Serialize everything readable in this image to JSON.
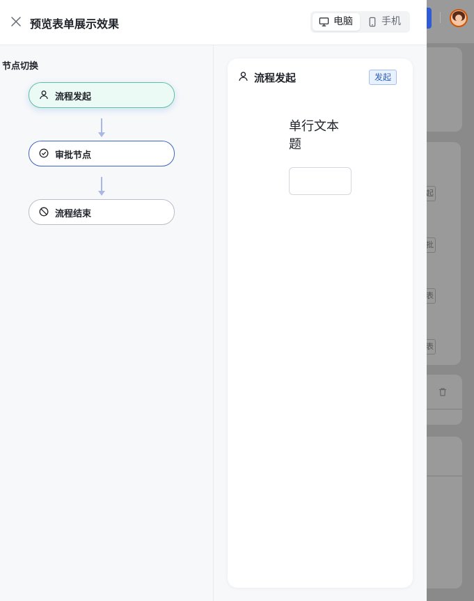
{
  "header": {
    "title": "预览表单展示效果",
    "view_toggle": [
      {
        "label": "电脑",
        "icon": "monitor-icon",
        "active": true
      },
      {
        "label": "手机",
        "icon": "phone-icon",
        "active": false
      }
    ]
  },
  "node_switch": {
    "title": "节点切换",
    "nodes": [
      {
        "label": "流程发起",
        "icon": "user-icon",
        "state": "selected"
      },
      {
        "label": "审批节点",
        "icon": "check-circle-icon",
        "state": "default"
      },
      {
        "label": "流程结束",
        "icon": "ban-icon",
        "state": "default"
      }
    ]
  },
  "preview": {
    "node_title": "流程发起",
    "node_tag": "发起",
    "field": {
      "label": "单行文本题",
      "value": "",
      "placeholder": ""
    }
  },
  "background": {
    "chips": [
      "起",
      "批",
      "表",
      "表"
    ]
  },
  "colors": {
    "accent": "#3c63c9",
    "selected_node_bg": "#ecfaf5",
    "selected_node_border": "#5fbfa3",
    "tag_bg": "#e8f1fd",
    "tag_text": "#2b5fb8",
    "overlay": "#8c8c8c"
  }
}
